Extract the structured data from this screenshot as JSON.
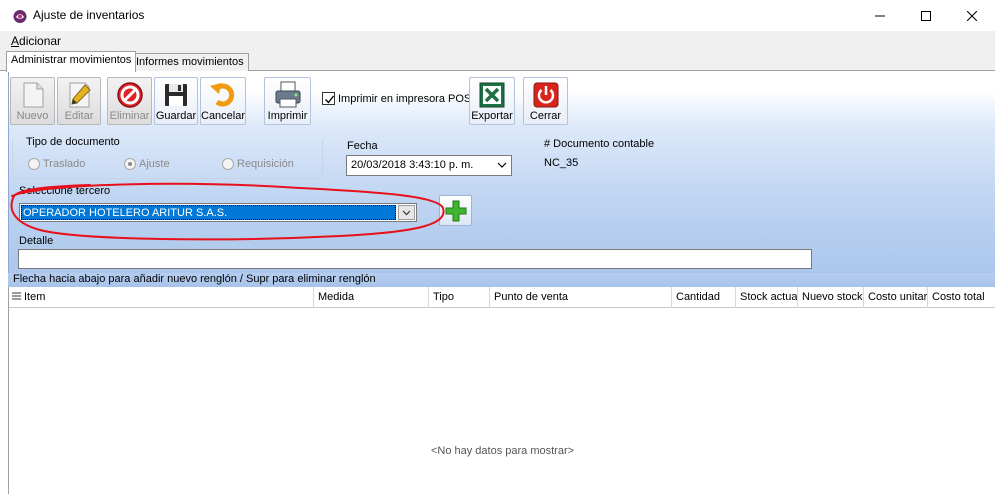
{
  "window": {
    "title": "Ajuste de inventarios",
    "controls": [
      "minimize",
      "maximize",
      "close"
    ]
  },
  "menu": {
    "items": [
      {
        "label": "Adicionar",
        "accelerator": "A",
        "rest": "dicionar"
      }
    ]
  },
  "tabs": [
    {
      "label": "Administrar movimientos",
      "active": true
    },
    {
      "label": "Informes movimientos",
      "active": false
    }
  ],
  "toolbar": {
    "nuevo": {
      "label": "Nuevo",
      "enabled": false,
      "icon": "new-document-icon"
    },
    "editar": {
      "label": "Editar",
      "enabled": false,
      "icon": "pencil-icon"
    },
    "eliminar": {
      "label": "Eliminar",
      "enabled": false,
      "icon": "delete-icon"
    },
    "guardar": {
      "label": "Guardar",
      "enabled": true,
      "icon": "floppy-disk-icon"
    },
    "cancelar": {
      "label": "Cancelar",
      "enabled": true,
      "icon": "undo-arrow-icon"
    },
    "imprimir": {
      "label": "Imprimir",
      "enabled": true,
      "icon": "printer-icon"
    },
    "exportar": {
      "label": "Exportar",
      "enabled": true,
      "icon": "excel-icon"
    },
    "cerrar": {
      "label": "Cerrar",
      "enabled": true,
      "icon": "power-icon"
    },
    "pos_checkbox": {
      "label": "Imprimir en impresora POS",
      "checked": true
    }
  },
  "form": {
    "tipo_documento": {
      "label": "Tipo de documento",
      "options": [
        {
          "label": "Traslado",
          "checked": false
        },
        {
          "label": "Ajuste",
          "checked": true
        },
        {
          "label": "Requisición",
          "checked": false
        }
      ]
    },
    "fecha": {
      "label": "Fecha",
      "value": "20/03/2018 3:43:10 p. m."
    },
    "documento_contable": {
      "label": "# Documento contable",
      "value": "NC_35"
    },
    "tercero": {
      "label": "Seleccione tercero",
      "value": "OPERADOR HOTELERO ARITUR S.A.S."
    },
    "detalle": {
      "label": "Detalle",
      "value": ""
    }
  },
  "grid": {
    "hint": "Flecha hacia abajo para añadir nuevo renglón / Supr para eliminar renglón",
    "columns": [
      "Item",
      "Medida",
      "Tipo",
      "Punto de venta",
      "Cantidad",
      "Stock actua",
      "Nuevo stock",
      "Costo unitari",
      "Costo total"
    ],
    "empty_text": "<No hay datos para mostrar>"
  },
  "colors": {
    "selection": "#0078d7",
    "panel_gradient_bottom": "#a8c5ec",
    "annotation": "#e8101a"
  }
}
